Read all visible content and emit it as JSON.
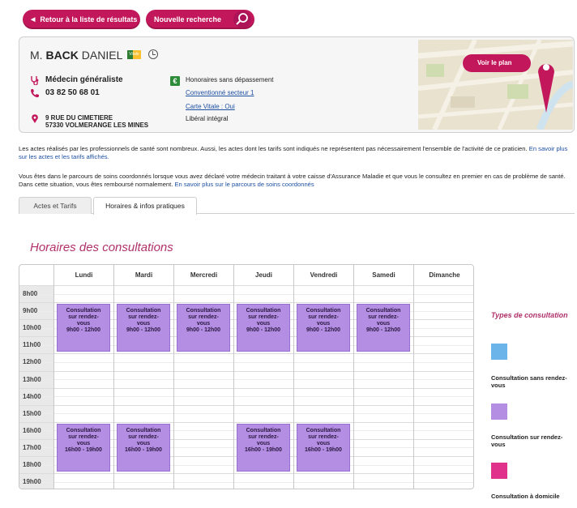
{
  "nav": {
    "back_label": "Retour à la liste de résultats",
    "new_search_label": "Nouvelle recherche"
  },
  "doctor": {
    "title": "M.",
    "last_name": "BACK",
    "first_name": "DANIEL",
    "vitale_badge": "Vitale",
    "specialty": "Médecin généraliste",
    "phone": "03 82 50 68 01",
    "address_line1": "9 RUE DU CIMETIERE",
    "address_line2": "57330 VOLMERANGE LES MINES",
    "fees": "Honoraires sans dépassement",
    "convention": "Conventionné secteur 1",
    "carte_vitale": "Carte Vitale : Oui",
    "practice": "Libéral intégral"
  },
  "map": {
    "button_label": "Voir le plan"
  },
  "info": {
    "p1_text": "Les actes réalisés par les professionnels de santé sont nombreux. Aussi, les actes dont les tarifs sont indiqués ne représentent pas nécessairement l'ensemble de l'activité de ce praticien.",
    "p1_link": "En savoir plus sur les actes et les tarifs affichés.",
    "p2_text": "Vous êtes dans le parcours de soins coordonnés lorsque vous avez déclaré votre médecin traitant à votre caisse d'Assurance Maladie et que vous le consultez en premier en cas de problème de santé. Dans cette situation, vous êtes remboursé normalement.",
    "p2_link": "En savoir plus sur le parcours de soins coordonnés"
  },
  "tabs": [
    {
      "label": "Actes et Tarifs"
    },
    {
      "label": "Horaires & infos pratiques"
    }
  ],
  "schedule": {
    "title": "Horaires des consultations",
    "days": [
      "Lundi",
      "Mardi",
      "Mercredi",
      "Jeudi",
      "Vendredi",
      "Samedi",
      "Dimanche"
    ],
    "hours": [
      "8h00",
      "9h00",
      "10h00",
      "11h00",
      "12h00",
      "13h00",
      "14h00",
      "15h00",
      "16h00",
      "17h00",
      "18h00",
      "19h00"
    ],
    "slot_line1": "Consultation",
    "slot_line2": "sur rendez-",
    "slot_line3": "vous",
    "morning_time": "9h00 - 12h00",
    "afternoon_time": "16h00 - 19h00",
    "morning_days": [
      0,
      1,
      2,
      3,
      4,
      5
    ],
    "afternoon_days": [
      0,
      1,
      3,
      4
    ]
  },
  "legend": {
    "title": "Types de consultation",
    "items": [
      {
        "label": "Consultation sans rendez-vous",
        "color": "#6ab4ea"
      },
      {
        "label": "Consultation sur rendez-vous",
        "color": "#b48ee3"
      },
      {
        "label": "Consultation à domicile",
        "color": "#e0328a"
      }
    ]
  },
  "colors": {
    "accent": "#c2185b",
    "link": "#1e50a2",
    "slot": "#b48ee3"
  }
}
